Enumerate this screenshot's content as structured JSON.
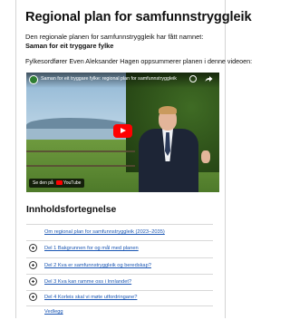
{
  "page": {
    "title": "Regional plan for samfunnstryggleik",
    "intro_text": "Den regionale planen for samfunnstryggleik har fått namnet:",
    "plan_name": "Saman for eit tryggare fylke",
    "byline": "Fylkesordfører Even Aleksander Hagen oppsummerer planen i denne videoen:"
  },
  "video": {
    "title": "Saman for eit tryggare fylke: regional plan for samfunnstryggleik",
    "watch_label": "Se den på",
    "watch_platform": "YouTube",
    "play_icon": "play-icon",
    "channel_icon": "channel-logo-icon"
  },
  "toc": {
    "heading": "Innholdsfortegnelse",
    "items": [
      {
        "label": "Om regional plan for samfunnstryggleik (2023–2035)",
        "expandable": false
      },
      {
        "label": "Del 1 Bakgrunnen for og mål med planen",
        "expandable": true
      },
      {
        "label": "Del 2 Kva er samfunnstryggleik og beredskap?",
        "expandable": true
      },
      {
        "label": "Del 3 Kva kan ramme oss i Innlandet?",
        "expandable": true
      },
      {
        "label": "Del 4 Korleis skal vi møte utfordringane?",
        "expandable": true
      },
      {
        "label": "Vedlegg",
        "expandable": false
      }
    ]
  },
  "colors": {
    "link": "#1a56b3",
    "youtube_red": "#ff0000"
  }
}
